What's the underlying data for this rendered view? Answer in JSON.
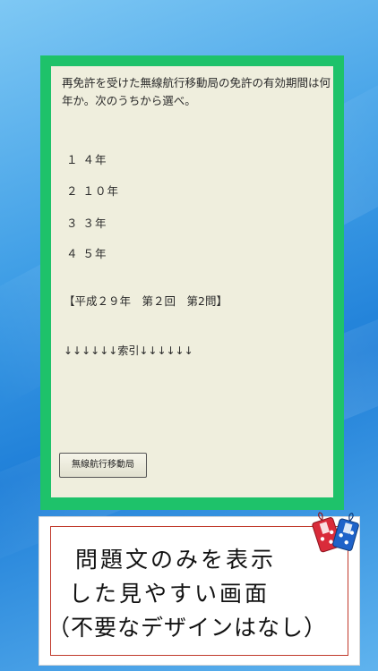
{
  "question": "再免許を受けた無線航行移動局の免許の有効期間は何年か。次のうちから選べ。",
  "choices": [
    "１ ４年",
    "２ １０年",
    "３ ３年",
    "４ ５年"
  ],
  "exam_info": "【平成２９年　第２回　第2問】",
  "index_divider": "↓↓↓↓↓↓索引↓↓↓↓↓↓",
  "category_button_label": "無線航行移動局",
  "caption": {
    "line1": "問題文のみを表示",
    "line2": "した見やすい画面",
    "line3": "（不要なデザインはなし）"
  },
  "colors": {
    "frame": "#1ec26a",
    "screen": "#efeedd",
    "caption_border": "#c0392b"
  },
  "icons": {
    "charm": "omamori-charm-icon"
  }
}
